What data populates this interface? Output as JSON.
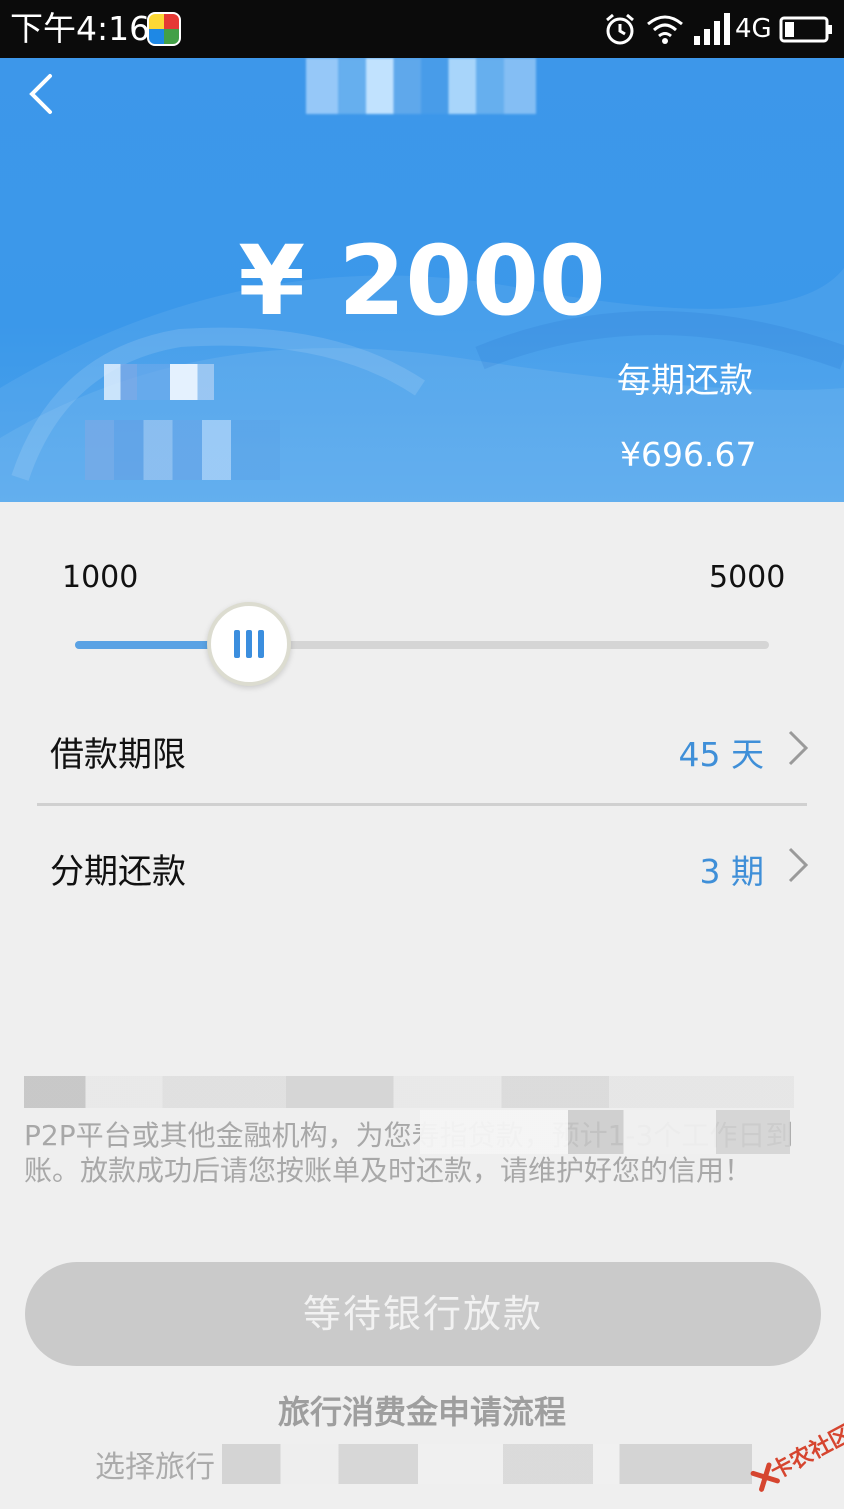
{
  "status_bar": {
    "time": "下午4:16",
    "network": "4G",
    "icons": [
      "app-icon",
      "alarm-icon",
      "wifi-icon",
      "signal-icon",
      "battery-icon"
    ]
  },
  "header": {
    "amount": "¥ 2000",
    "per_period_label": "每期还款",
    "per_period_value": "¥696.67",
    "background_color": "#3b98ea"
  },
  "slider": {
    "min_label": "1000",
    "max_label": "5000",
    "value_fraction": 0.25,
    "fill_color": "#5aa2e4"
  },
  "loan_term": {
    "label": "借款期限",
    "value": "45 天"
  },
  "installments": {
    "label": "分期还款",
    "value": "3 期"
  },
  "notice": {
    "text": "P2P平台或其他金融机构，为您寿指贷款，预计1-3个工作日到账。放款成功后请您按账单及时还款，请维护好您的信用！"
  },
  "action": {
    "wait_button_label": "等待银行放款"
  },
  "process": {
    "title": "旅行消费金申请流程",
    "text": "选择旅行"
  },
  "watermark": {
    "text": "卡农社区"
  }
}
